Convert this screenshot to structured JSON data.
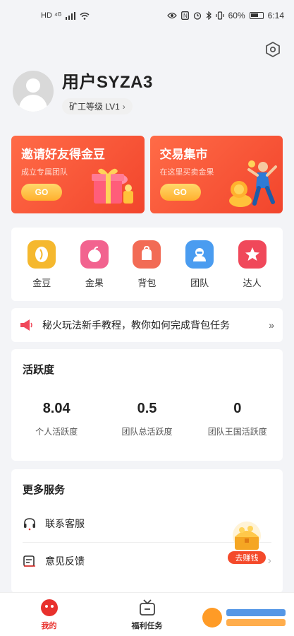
{
  "status_bar": {
    "left_icons": "HD ⁴ᴳ",
    "battery": "60%",
    "time": "6:14"
  },
  "profile": {
    "username": "用户SYZA3",
    "level": "矿工等级 LV1"
  },
  "promos": [
    {
      "title": "邀请好友得金豆",
      "subtitle": "成立专属团队",
      "button": "GO"
    },
    {
      "title": "交易集市",
      "subtitle": "在这里买卖金果",
      "button": "GO"
    }
  ],
  "features": [
    {
      "label": "金豆",
      "icon": "bean-icon",
      "color": "#f5b82e"
    },
    {
      "label": "金果",
      "icon": "apple-icon",
      "color": "#f2638f"
    },
    {
      "label": "背包",
      "icon": "backpack-icon",
      "color": "#f26b55"
    },
    {
      "label": "团队",
      "icon": "team-icon",
      "color": "#4a9cf0"
    },
    {
      "label": "达人",
      "icon": "star-icon",
      "color": "#f0485a"
    }
  ],
  "notice": {
    "text": "秘火玩法新手教程，教你如何完成背包任务",
    "more": "»"
  },
  "activity": {
    "title": "活跃度",
    "stats": [
      {
        "value": "8.04",
        "label": "个人活跃度"
      },
      {
        "value": "0.5",
        "label": "团队总活跃度"
      },
      {
        "value": "0",
        "label": "团队王国活跃度"
      }
    ]
  },
  "services": {
    "title": "更多服务",
    "items": [
      {
        "label": "联系客服",
        "icon": "headset-icon"
      },
      {
        "label": "意见反馈",
        "icon": "feedback-icon"
      }
    ],
    "earn_label": "去赚钱"
  },
  "tabs": [
    {
      "label": "我的",
      "icon": "profile-face-icon",
      "active": true
    },
    {
      "label": "福利任务",
      "icon": "tv-gift-icon",
      "active": false
    }
  ],
  "colors": {
    "accent": "#e8312d",
    "promo": "#f2452c",
    "go_button": "#ffb02e"
  }
}
